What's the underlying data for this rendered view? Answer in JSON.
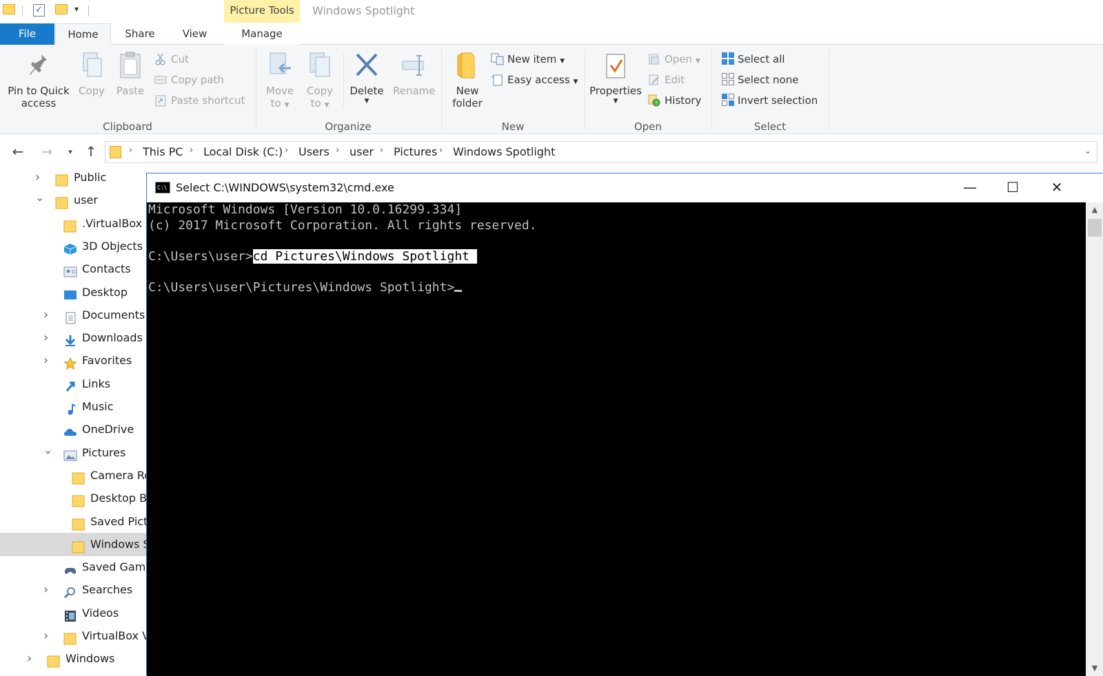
{
  "titlebar": {
    "context_tab": "Picture Tools",
    "window_title": "Windows Spotlight"
  },
  "tabs": {
    "file": "File",
    "home": "Home",
    "share": "Share",
    "view": "View",
    "manage": "Manage"
  },
  "ribbon": {
    "clipboard": {
      "label": "Clipboard",
      "pin_line1": "Pin to Quick",
      "pin_line2": "access",
      "copy": "Copy",
      "paste": "Paste",
      "cut": "Cut",
      "copy_path": "Copy path",
      "paste_shortcut": "Paste shortcut"
    },
    "organize": {
      "label": "Organize",
      "move_line1": "Move",
      "move_line2": "to",
      "copy_line1": "Copy",
      "copy_line2": "to",
      "delete": "Delete",
      "rename": "Rename"
    },
    "new": {
      "label": "New",
      "folder_line1": "New",
      "folder_line2": "folder",
      "new_item": "New item",
      "easy_access": "Easy access"
    },
    "open": {
      "label": "Open",
      "properties": "Properties",
      "open": "Open",
      "edit": "Edit",
      "history": "History"
    },
    "select": {
      "label": "Select",
      "select_all": "Select all",
      "select_none": "Select none",
      "invert": "Invert selection"
    }
  },
  "breadcrumb": [
    "This PC",
    "Local Disk (C:)",
    "Users",
    "user",
    "Pictures",
    "Windows Spotlight"
  ],
  "tree": [
    {
      "label": "Public",
      "indent": 1,
      "expand": "collapsed",
      "icon": "folder-icon"
    },
    {
      "label": "user",
      "indent": 1,
      "expand": "expanded",
      "icon": "folder-icon"
    },
    {
      "label": ".VirtualBox",
      "indent": 2,
      "expand": "none",
      "icon": "folder-icon"
    },
    {
      "label": "3D Objects",
      "indent": 2,
      "expand": "none",
      "icon": "3d-objects-icon"
    },
    {
      "label": "Contacts",
      "indent": 2,
      "expand": "none",
      "icon": "contacts-icon"
    },
    {
      "label": "Desktop",
      "indent": 2,
      "expand": "none",
      "icon": "desktop-icon"
    },
    {
      "label": "Documents",
      "indent": 2,
      "expand": "collapsed",
      "icon": "documents-icon"
    },
    {
      "label": "Downloads",
      "indent": 2,
      "expand": "collapsed",
      "icon": "downloads-icon"
    },
    {
      "label": "Favorites",
      "indent": 2,
      "expand": "collapsed",
      "icon": "favorites-icon"
    },
    {
      "label": "Links",
      "indent": 2,
      "expand": "none",
      "icon": "links-icon"
    },
    {
      "label": "Music",
      "indent": 2,
      "expand": "none",
      "icon": "music-icon"
    },
    {
      "label": "OneDrive",
      "indent": 2,
      "expand": "none",
      "icon": "onedrive-icon"
    },
    {
      "label": "Pictures",
      "indent": 2,
      "expand": "expanded",
      "icon": "pictures-icon"
    },
    {
      "label": "Camera Roll",
      "indent": 3,
      "expand": "none",
      "icon": "folder-icon"
    },
    {
      "label": "Desktop Bac",
      "indent": 3,
      "expand": "none",
      "icon": "folder-icon"
    },
    {
      "label": "Saved Pictur",
      "indent": 3,
      "expand": "none",
      "icon": "folder-icon"
    },
    {
      "label": "Windows Sp",
      "indent": 3,
      "expand": "none",
      "icon": "folder-icon",
      "selected": true
    },
    {
      "label": "Saved Games",
      "indent": 2,
      "expand": "none",
      "icon": "saved-games-icon"
    },
    {
      "label": "Searches",
      "indent": 2,
      "expand": "collapsed",
      "icon": "searches-icon"
    },
    {
      "label": "Videos",
      "indent": 2,
      "expand": "none",
      "icon": "videos-icon"
    },
    {
      "label": "VirtualBox VM",
      "indent": 2,
      "expand": "collapsed",
      "icon": "folder-icon"
    },
    {
      "label": "Windows",
      "indent": 0,
      "expand": "collapsed",
      "icon": "folder-icon"
    }
  ],
  "cmd": {
    "title": "Select C:\\WINDOWS\\system32\\cmd.exe",
    "icon_text": "C:\\",
    "minimize": "—",
    "maximize": "☐",
    "close": "✕",
    "line1": "Microsoft Windows [Version 10.0.16299.334]",
    "line2": "(c) 2017 Microsoft Corporation. All rights reserved.",
    "prompt1": "C:\\Users\\user>",
    "command1": "cd Pictures\\Windows Spotlight ",
    "prompt2": "C:\\Users\\user\\Pictures\\Windows Spotlight>"
  },
  "colors": {
    "file_tab": "#1979ca",
    "context_tab": "#fff2a8",
    "window_border": "#2b7bd6",
    "console_bg": "#000000",
    "console_fg": "#c0c0c0"
  }
}
